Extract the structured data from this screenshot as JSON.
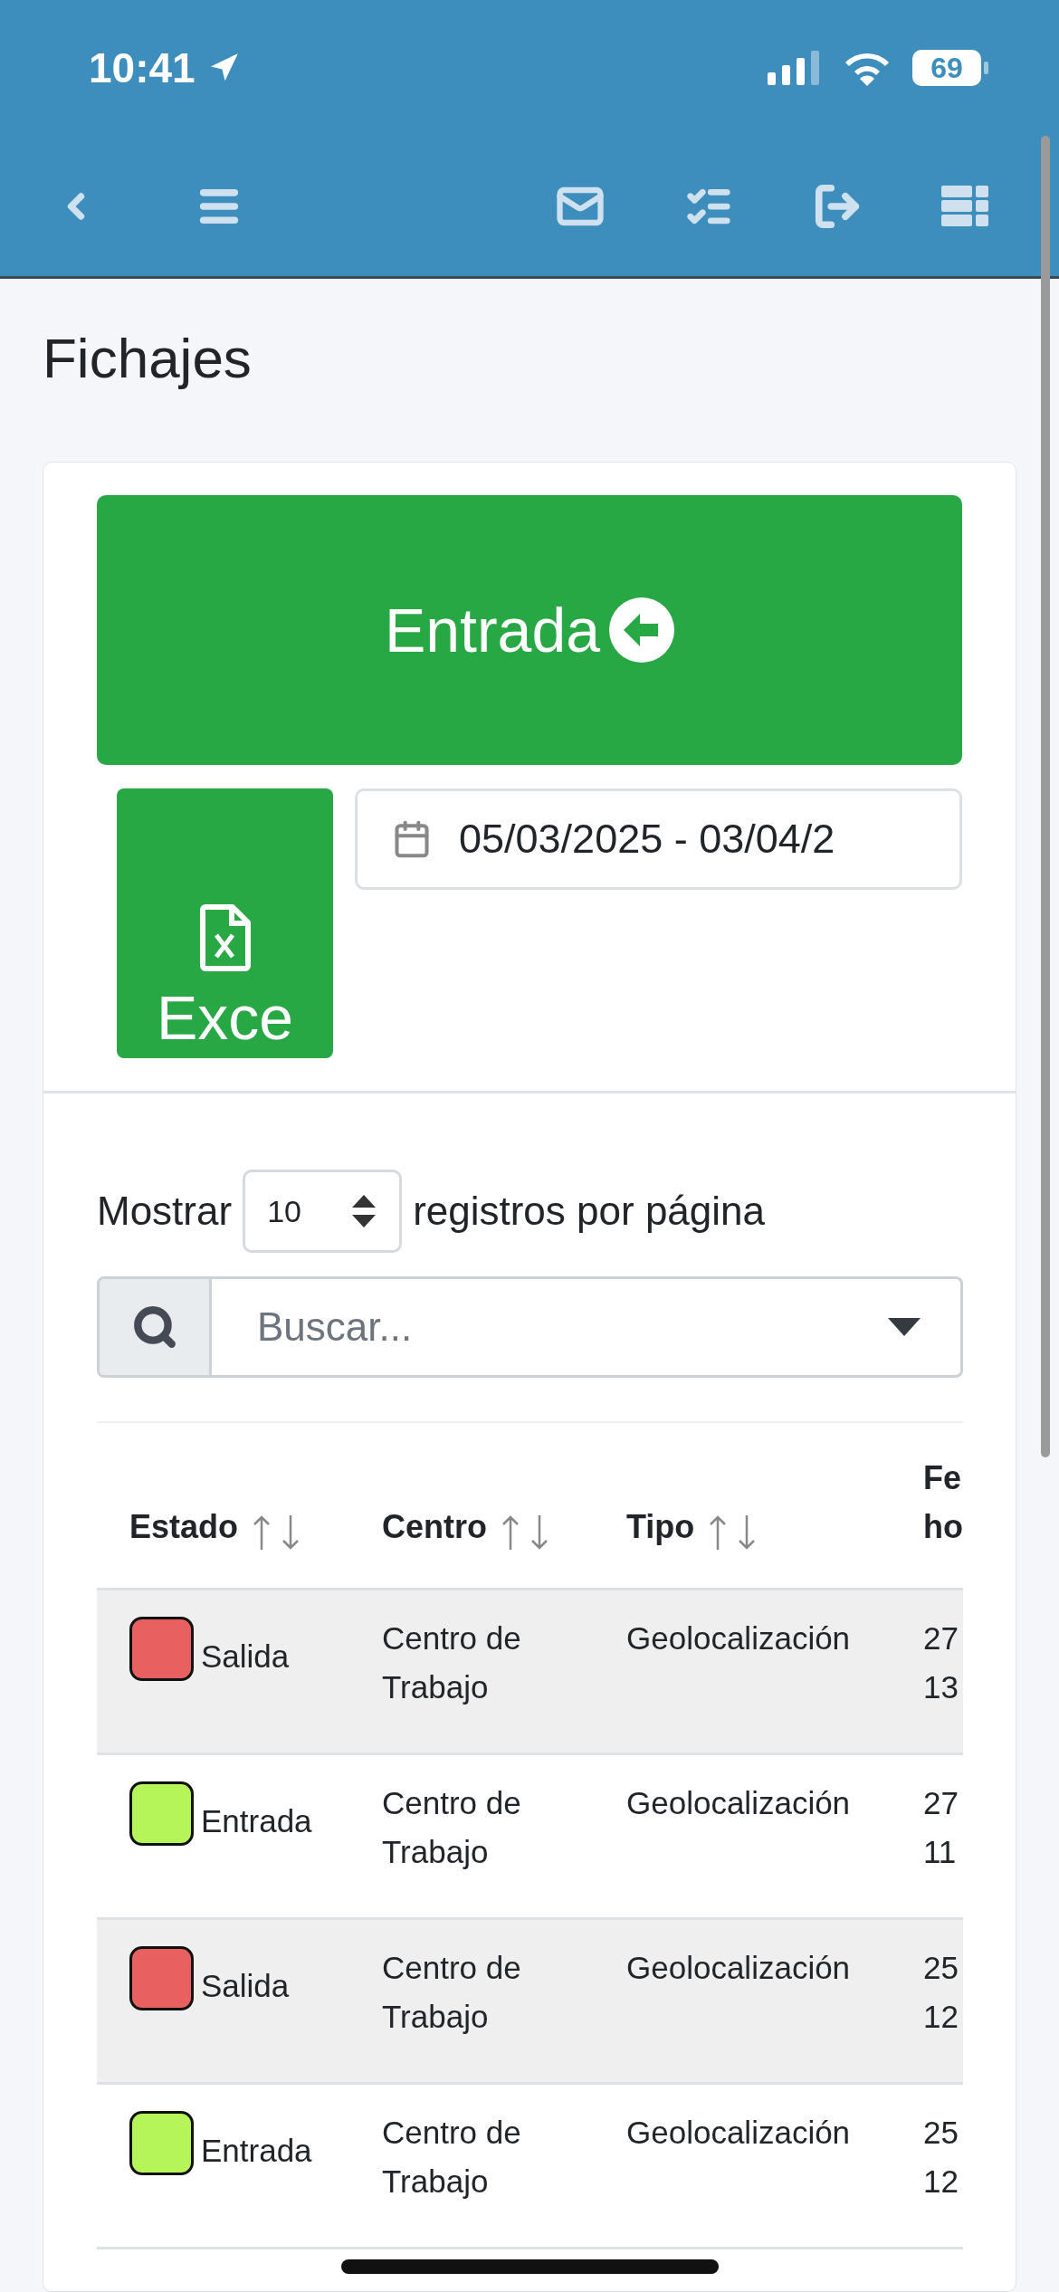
{
  "status_bar": {
    "time": "10:41",
    "battery": "69"
  },
  "page": {
    "title": "Fichajes"
  },
  "actions": {
    "clock_button": "Entrada",
    "export_button": "Exce",
    "date_range": "05/03/2025 - 03/04/2"
  },
  "length": {
    "prefix": "Mostrar",
    "value": "10",
    "suffix": "registros por página"
  },
  "search": {
    "placeholder": "Buscar..."
  },
  "table": {
    "columns": [
      {
        "lines": [
          "Estado"
        ],
        "sortable": true
      },
      {
        "lines": [
          "Centro"
        ],
        "sortable": true
      },
      {
        "lines": [
          "Tipo"
        ],
        "sortable": true
      },
      {
        "lines": [
          "Fe",
          "ho"
        ],
        "sortable": false
      }
    ],
    "rows": [
      {
        "status": "Salida",
        "color": "#e86060",
        "centro": "Centro de Trabajo",
        "tipo": "Geolocalización",
        "fecha": [
          "27",
          "13"
        ]
      },
      {
        "status": "Entrada",
        "color": "#b5f55a",
        "centro": "Centro de Trabajo",
        "tipo": "Geolocalización",
        "fecha": [
          "27",
          "11"
        ]
      },
      {
        "status": "Salida",
        "color": "#e86060",
        "centro": "Centro de Trabajo",
        "tipo": "Geolocalización",
        "fecha": [
          "25",
          "12"
        ]
      },
      {
        "status": "Entrada",
        "color": "#b5f55a",
        "centro": "Centro de Trabajo",
        "tipo": "Geolocalización",
        "fecha": [
          "25",
          "12"
        ]
      }
    ]
  }
}
